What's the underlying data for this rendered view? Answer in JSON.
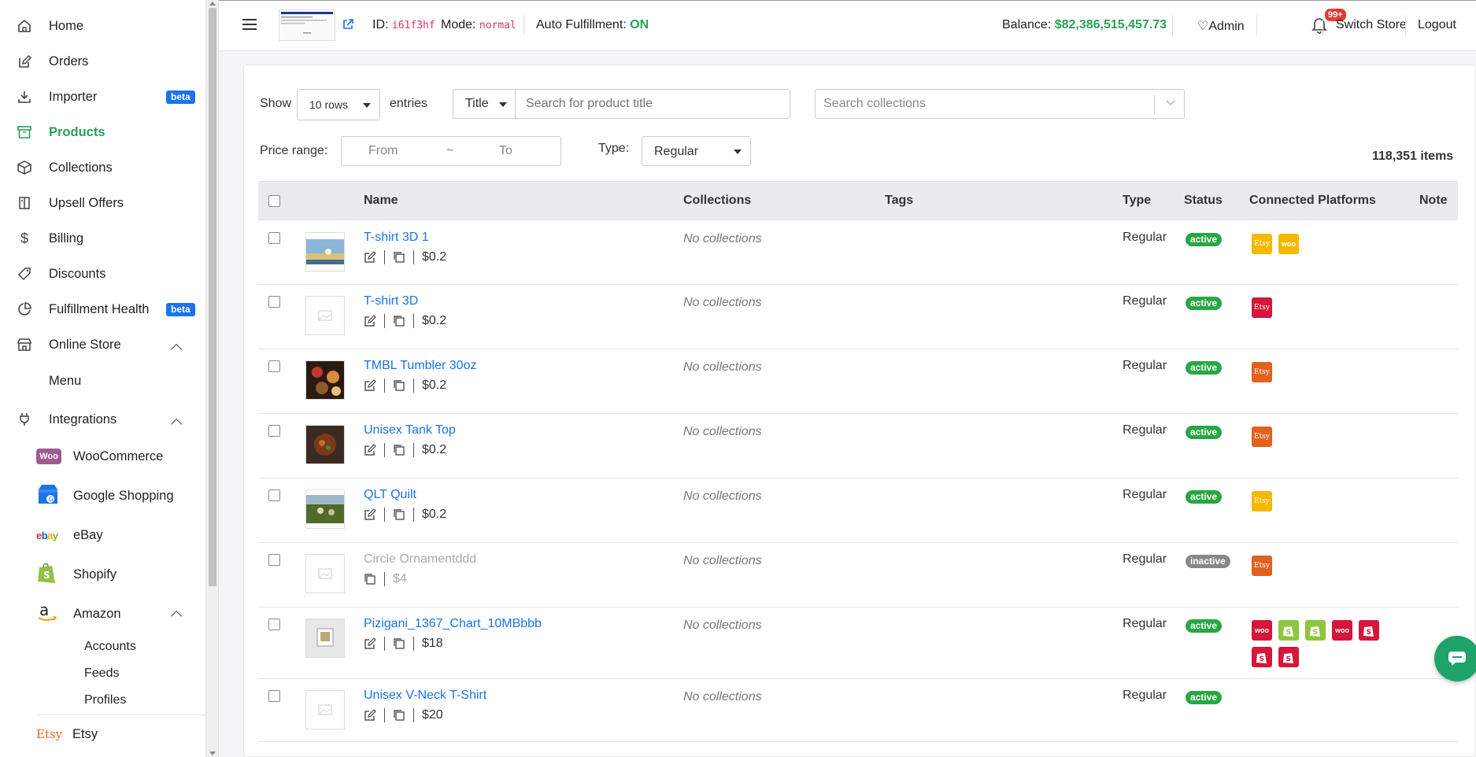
{
  "sidebar": {
    "items": [
      {
        "label": "Home",
        "icon": "home-icon"
      },
      {
        "label": "Orders",
        "icon": "edit-icon"
      },
      {
        "label": "Importer",
        "icon": "download-icon",
        "badge": "beta"
      },
      {
        "label": "Products",
        "icon": "archive-icon",
        "active": true
      },
      {
        "label": "Collections",
        "icon": "box-icon"
      },
      {
        "label": "Upsell Offers",
        "icon": "book-icon"
      },
      {
        "label": "Billing",
        "icon": "dollar-icon"
      },
      {
        "label": "Discounts",
        "icon": "tag-icon"
      },
      {
        "label": "Fulfillment Health",
        "icon": "pie-chart-icon",
        "badge": "beta"
      },
      {
        "label": "Online Store",
        "icon": "store-icon"
      },
      {
        "label": "Integrations",
        "icon": "plug-icon"
      }
    ],
    "online_store_sub": [
      "Menu"
    ],
    "integrations": [
      "WooCommerce",
      "Google Shopping",
      "eBay",
      "Shopify",
      "Amazon"
    ],
    "amazon_sub": [
      "Accounts",
      "Feeds",
      "Profiles"
    ],
    "etsy": "Etsy",
    "badge_label": "beta"
  },
  "topbar": {
    "id_label": "ID:",
    "id_value": "i61f3hf",
    "mode_label": "Mode:",
    "mode_value": "normal",
    "auto_label": "Auto Fulfillment:",
    "auto_value": "ON",
    "balance_label": "Balance:",
    "balance_value": "$82,386,515,457.73",
    "admin": "Admin",
    "notif_count": "99+",
    "switch_store": "Switch Store",
    "logout": "Logout"
  },
  "filters": {
    "show": "Show",
    "rows": "10 rows",
    "entries": "entries",
    "field": "Title",
    "search_placeholder": "Search for product title",
    "collections_placeholder": "Search collections",
    "price_range": "Price range:",
    "from": "From",
    "tilde": "~",
    "to": "To",
    "type_label": "Type:",
    "type_value": "Regular",
    "items_count": "118,351 items"
  },
  "table": {
    "headers": {
      "name": "Name",
      "collections": "Collections",
      "tags": "Tags",
      "type": "Type",
      "status": "Status",
      "platforms": "Connected Platforms",
      "note": "Note"
    },
    "rows": [
      {
        "name": "T-shirt 3D 1",
        "price": "$0.2",
        "collections": "No collections",
        "type": "Regular",
        "status": "active",
        "thumb": "sky",
        "platforms": [
          {
            "t": "Etsy",
            "c": "#f5b800"
          },
          {
            "t": "woo",
            "c": "#f5b800"
          }
        ]
      },
      {
        "name": "T-shirt 3D",
        "price": "$0.2",
        "collections": "No collections",
        "type": "Regular",
        "status": "active",
        "thumb": "placeholder",
        "platforms": [
          {
            "t": "Etsy",
            "c": "#d6163a"
          }
        ]
      },
      {
        "name": "TMBL Tumbler 30oz",
        "price": "$0.2",
        "collections": "No collections",
        "type": "Regular",
        "status": "active",
        "thumb": "food",
        "platforms": [
          {
            "t": "Etsy",
            "c": "#e0621e"
          }
        ]
      },
      {
        "name": "Unisex Tank Top",
        "price": "$0.2",
        "collections": "No collections",
        "type": "Regular",
        "status": "active",
        "thumb": "dish",
        "platforms": [
          {
            "t": "Etsy",
            "c": "#e0621e"
          }
        ]
      },
      {
        "name": "QLT Quilt",
        "price": "$0.2",
        "collections": "No collections",
        "type": "Regular",
        "status": "active",
        "thumb": "grass",
        "platforms": [
          {
            "t": "Etsy",
            "c": "#f5b800"
          }
        ]
      },
      {
        "name": "Circle Ornamentddd",
        "price": "$4",
        "collections": "No collections",
        "type": "Regular",
        "status": "inactive",
        "thumb": "placeholder",
        "platforms": [
          {
            "t": "Etsy",
            "c": "#e0621e"
          }
        ]
      },
      {
        "name": "Pizigani_1367_Chart_10MBbbb",
        "price": "$18",
        "collections": "No collections",
        "type": "Regular",
        "status": "active",
        "thumb": "frame",
        "platforms": [
          {
            "t": "woo",
            "c": "#d6163a"
          },
          {
            "t": "shop",
            "c": "#8dc63f"
          },
          {
            "t": "shop",
            "c": "#8dc63f"
          },
          {
            "t": "woo",
            "c": "#d6163a"
          },
          {
            "t": "shop",
            "c": "#d6163a"
          },
          {
            "t": "shop",
            "c": "#d6163a"
          },
          {
            "t": "shop",
            "c": "#d6163a"
          }
        ]
      },
      {
        "name": "Unisex V-Neck T-Shirt",
        "price": "$20",
        "collections": "No collections",
        "type": "Regular",
        "status": "active",
        "thumb": "placeholder",
        "platforms": []
      }
    ]
  }
}
